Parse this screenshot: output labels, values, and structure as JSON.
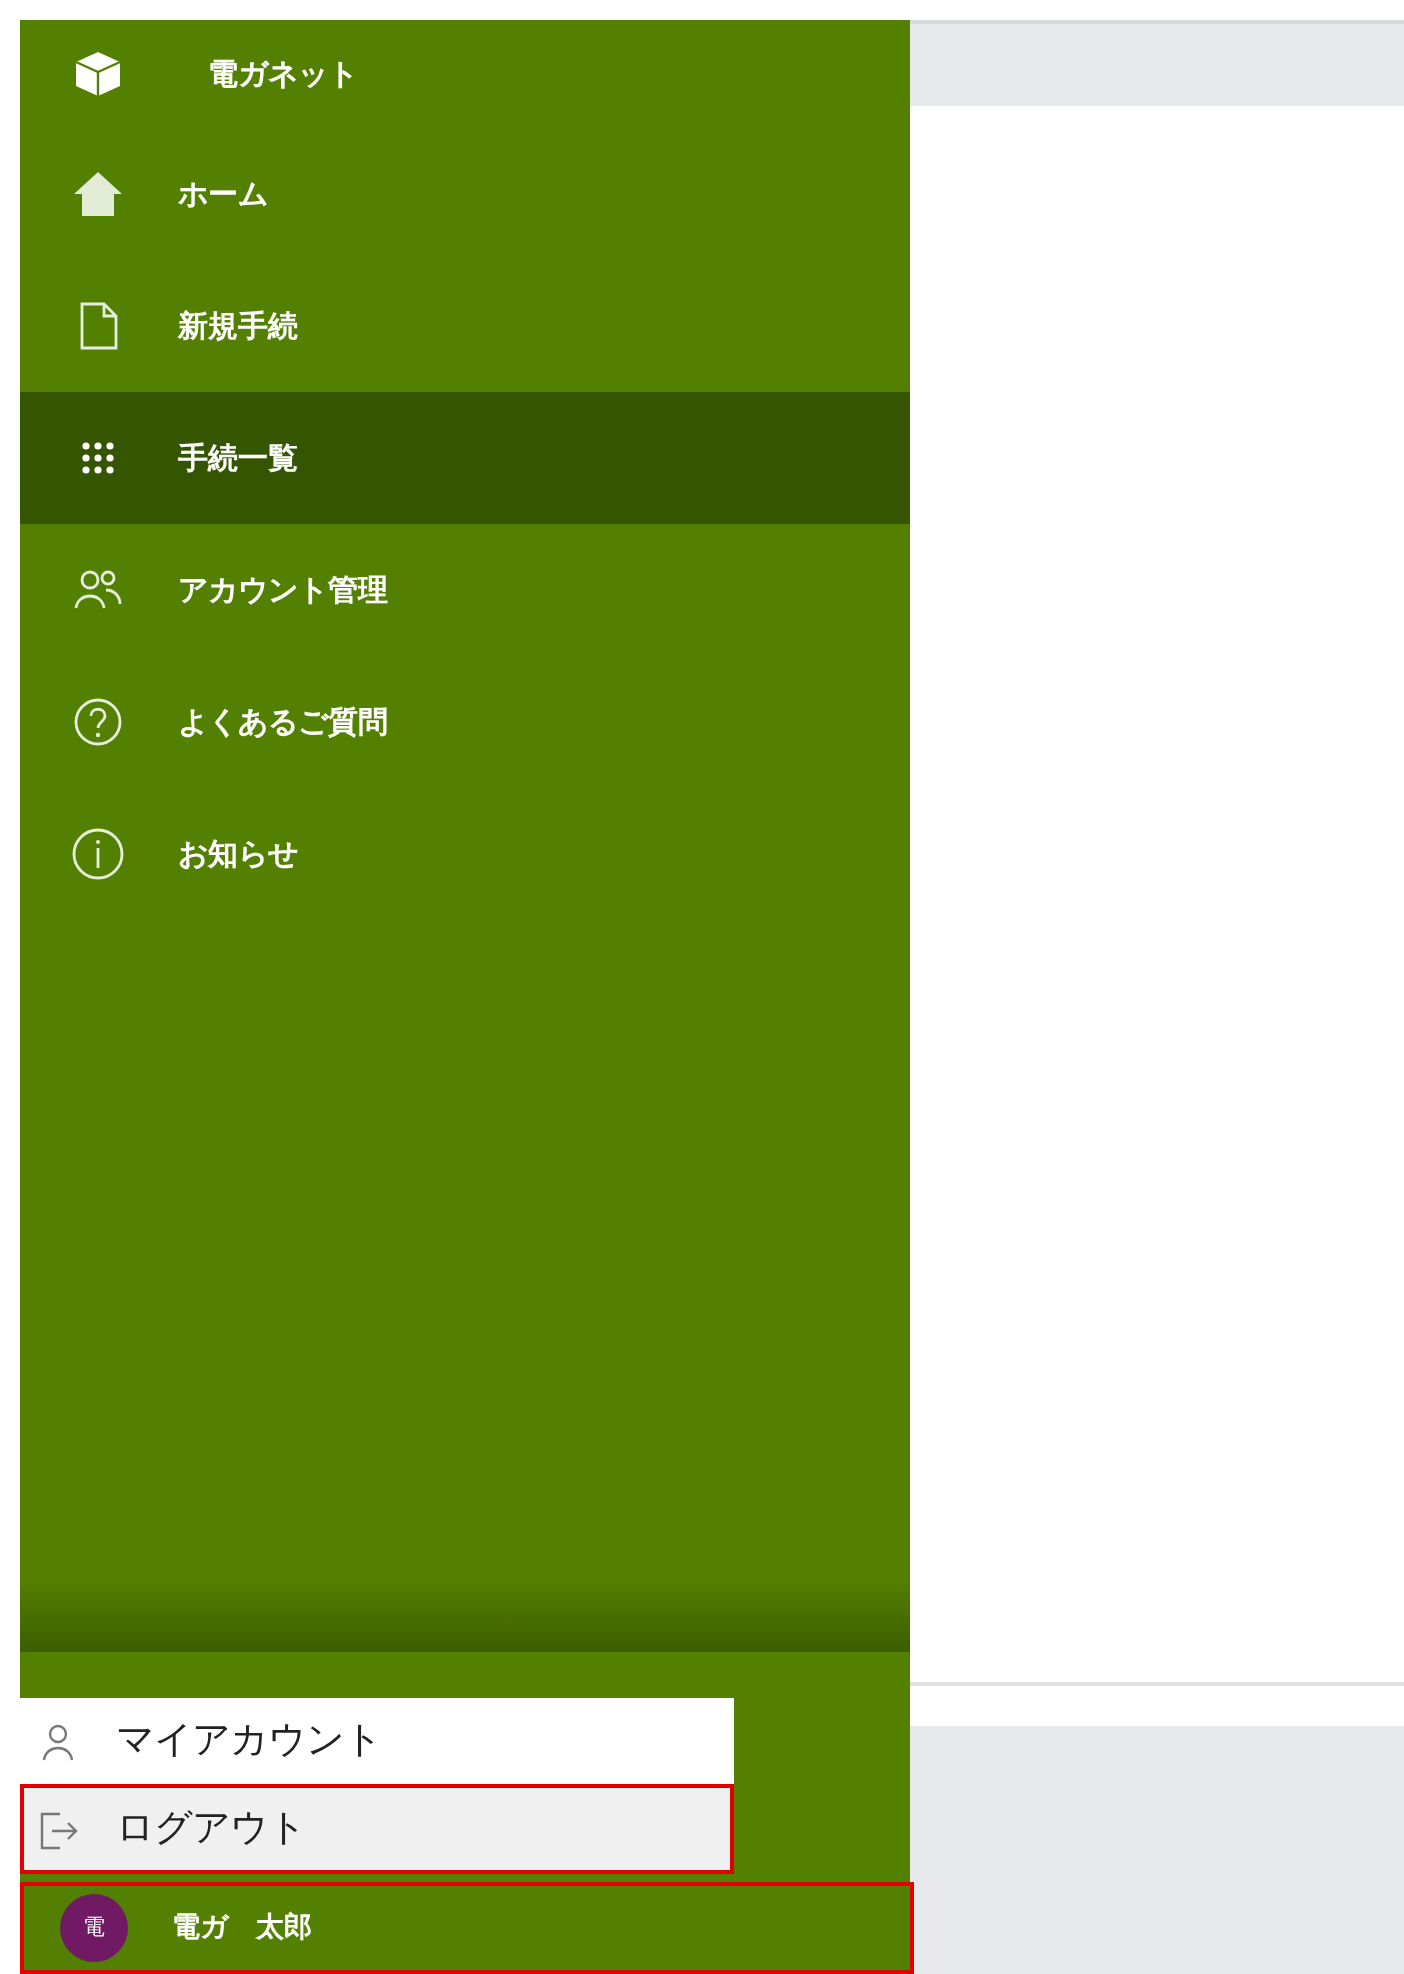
{
  "app": {
    "title": "電ガネット"
  },
  "nav_items": [
    {
      "label": "ホーム",
      "kind": "home",
      "selected": false
    },
    {
      "label": "新規手続",
      "kind": "document",
      "selected": false
    },
    {
      "label": "手続一覧",
      "kind": "grid",
      "selected": true
    },
    {
      "label": "アカウント管理",
      "kind": "people",
      "selected": false
    },
    {
      "label": "よくあるご質問",
      "kind": "question",
      "selected": false
    },
    {
      "label": "お知らせ",
      "kind": "info",
      "selected": false
    }
  ],
  "user_menu": [
    {
      "label": "マイアカウント",
      "kind": "person",
      "highlighted": false
    },
    {
      "label": "ログアウト",
      "kind": "logout",
      "highlighted": true
    }
  ],
  "user": {
    "avatar": "電",
    "name": "電ガ　太郎",
    "highlighted": true
  }
}
